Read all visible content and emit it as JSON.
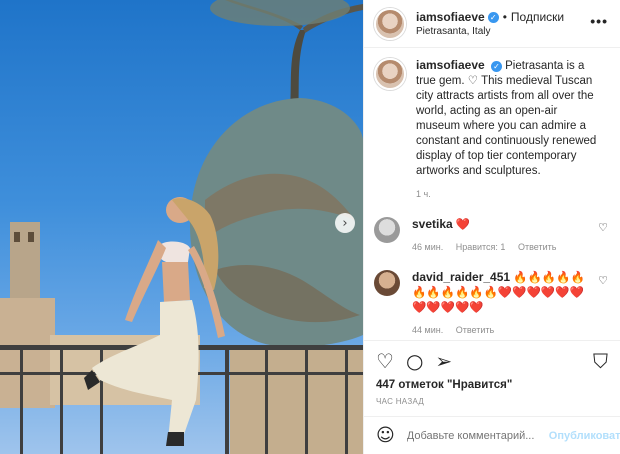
{
  "header": {
    "username": "iamsofiaeve",
    "separator": "•",
    "follow_label": "Подписки",
    "location": "Pietrasanta, Italy",
    "more_label": "•••"
  },
  "caption": {
    "username": "iamsofiaeve",
    "text": "Pietrasanta is a true gem. ♡ This medieval Tuscan city attracts artists from all over the world, acting as an open-air museum where you can admire a constant and continuously renewed display of top tier contemporary artworks and sculptures.",
    "time": "1 ч."
  },
  "comments": [
    {
      "username": "svetika",
      "text": "❤️",
      "time": "46 мин.",
      "likes": "Нравится: 1",
      "reply": "Ответить"
    },
    {
      "username": "david_raider_451",
      "text": "🔥🔥🔥🔥🔥🔥🔥🔥🔥🔥🔥❤️❤️❤️❤️❤️❤️❤️❤️❤️❤️❤️",
      "time": "44 мин.",
      "reply": "Ответить"
    }
  ],
  "actions": {
    "likes_text": "447 отметок \"Нравится\"",
    "posted_ago": "ЧАС НАЗАД"
  },
  "add_comment": {
    "placeholder": "Добавьте комментарий...",
    "publish_label": "Опубликовать"
  },
  "photo": {
    "next_label": "›"
  }
}
